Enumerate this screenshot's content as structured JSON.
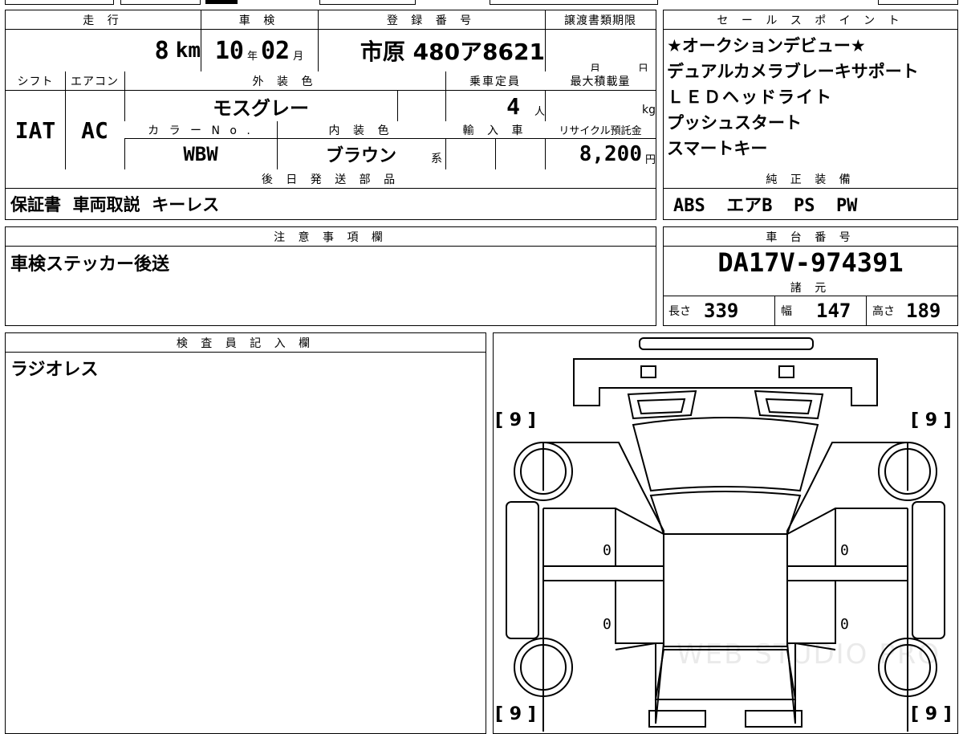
{
  "headers": {
    "mileage": "走 行",
    "inspection": "車 検",
    "registration": "登 録 番 号",
    "transfer_deadline": "譲渡書類期限",
    "shift": "シフト",
    "aircon": "エアコン",
    "exterior_color": "外 装 色",
    "capacity": "乗車定員",
    "max_load": "最大積載量",
    "color_no": "カ ラ ー N o .",
    "interior_color": "内 装 色",
    "import": "輸 入 車",
    "recycle_fee": "リサイクル預託金",
    "later_parts": "後 日 発 送 部 品",
    "sales_points": "セ ー ル ス ポ イ ン ト",
    "standard_equipment": "純 正 装 備",
    "notes": "注 意 事 項 欄",
    "chassis_no": "車 台 番 号",
    "specs": "諸 元",
    "inspector": "検 査 員 記 入 欄"
  },
  "vehicle": {
    "mileage_value": "8",
    "mileage_unit": "km",
    "inspection_year": "10",
    "year_unit": "年",
    "inspection_month": "02",
    "month_unit": "月",
    "registration": "市原 480ア8621",
    "transfer_month_unit": "月",
    "transfer_day_unit": "日",
    "shift": "IAT",
    "aircon": "AC",
    "exterior_color": "モスグレー",
    "capacity_value": "4",
    "capacity_unit": "人",
    "max_load_unit": "kg",
    "color_no": "WBW",
    "interior_color": "ブラウン",
    "interior_suffix": "系",
    "recycle_value": "8,200",
    "recycle_unit": "円"
  },
  "later_parts": "保証書  車両取説  キーレス",
  "sales_points": [
    "★オークションデビュー★",
    "デュアルカメラブレーキサポート",
    "ＬＥＤヘッドライト",
    "プッシュスタート",
    "スマートキー"
  ],
  "standard_equipment": "ABS  エアB  PS  PW",
  "notes": "車検ステッカー後送",
  "chassis_no": "DA17V-974391",
  "specs": {
    "length_label": "長さ",
    "length": "339",
    "width_label": "幅",
    "width": "147",
    "height_label": "高さ",
    "height": "189"
  },
  "inspector_note": "ラジオレス",
  "diagram": {
    "tire_fl": "[ 9 ]",
    "tire_fr": "[ 9 ]",
    "tire_rl": "[ 9 ]",
    "tire_rr": "[ 9 ]",
    "zero": "0"
  },
  "watermark": "WEB STUDIO PRO"
}
